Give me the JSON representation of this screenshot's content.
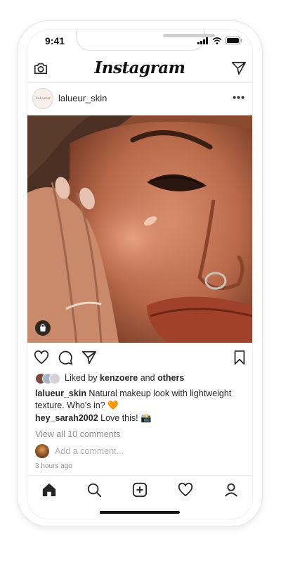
{
  "status_bar": {
    "time": "9:41"
  },
  "header": {
    "logo": "Instagram"
  },
  "post": {
    "avatar_text": "LaLueur",
    "username": "lalueur_skin",
    "more": "•••",
    "liked_prefix": "Liked by ",
    "liked_user": "kenzoere",
    "liked_and": " and ",
    "liked_others": "others",
    "caption_user": "lalueur_skin",
    "caption_text": " Natural makeup look with lightweight texture. Who's in? 🧡",
    "comment_user": "hey_sarah2002",
    "comment_text": " Love this! 📸",
    "view_all": "View all 10 comments",
    "add_comment_placeholder": "Add a comment...",
    "time_ago": "3 hours ago"
  },
  "icons": [
    "camera-icon",
    "direct-send-icon",
    "like-heart-icon",
    "comment-icon",
    "share-icon",
    "bookmark-icon",
    "shopping-bag-icon",
    "home-icon",
    "search-icon",
    "new-post-icon",
    "activity-heart-icon",
    "profile-icon"
  ]
}
